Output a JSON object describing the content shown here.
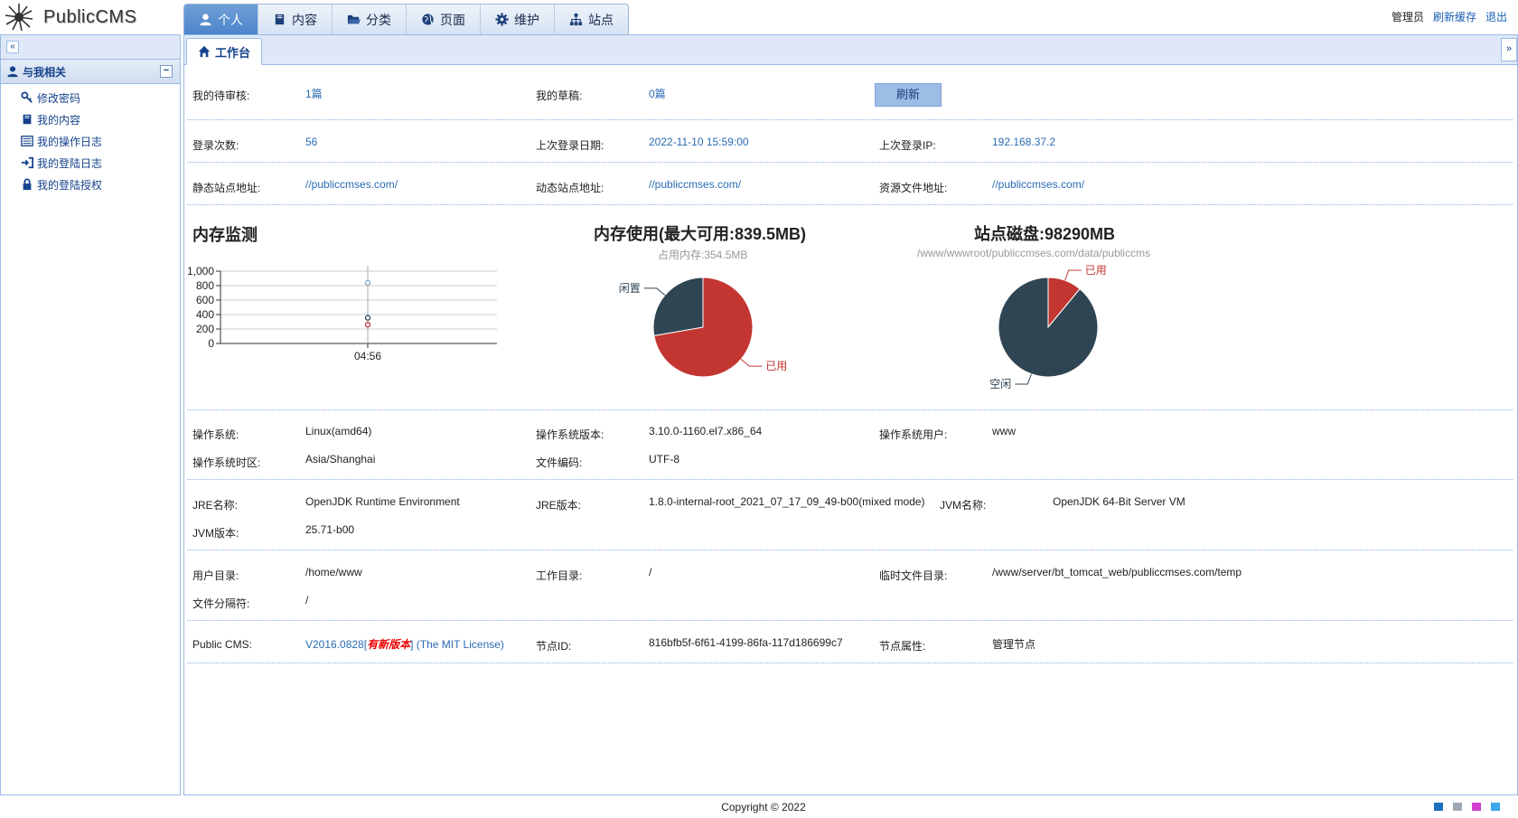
{
  "app": {
    "logo_text": "PublicCMS"
  },
  "nav": {
    "tabs": [
      {
        "label": "个人",
        "icon": "user-icon"
      },
      {
        "label": "内容",
        "icon": "book-icon"
      },
      {
        "label": "分类",
        "icon": "folder-open-icon"
      },
      {
        "label": "页面",
        "icon": "globe-icon"
      },
      {
        "label": "维护",
        "icon": "gear-icon"
      },
      {
        "label": "站点",
        "icon": "sitemap-icon"
      }
    ]
  },
  "header_right": {
    "user": "管理员",
    "refresh_cache": "刷新缓存",
    "logout": "退出"
  },
  "sidebar": {
    "section_title": "与我相关",
    "items": [
      {
        "label": "修改密码",
        "icon": "key-icon"
      },
      {
        "label": "我的内容",
        "icon": "book-icon"
      },
      {
        "label": "我的操作日志",
        "icon": "list-icon"
      },
      {
        "label": "我的登陆日志",
        "icon": "sign-in-icon"
      },
      {
        "label": "我的登陆授权",
        "icon": "lock-icon"
      }
    ]
  },
  "tabbar": {
    "active_tab": "工作台"
  },
  "info": {
    "pending_label": "我的待审核:",
    "pending_value": "1篇",
    "draft_label": "我的草稿:",
    "draft_value": "0篇",
    "refresh_button": "刷新",
    "login_count_label": "登录次数:",
    "login_count_value": "56",
    "last_login_date_label": "上次登录日期:",
    "last_login_date_value": "2022-11-10 15:59:00",
    "last_login_ip_label": "上次登录IP:",
    "last_login_ip_value": "192.168.37.2",
    "static_site_label": "静态站点地址:",
    "static_site_value": "//publiccmses.com/",
    "dynamic_site_label": "动态站点地址:",
    "dynamic_site_value": "//publiccmses.com/",
    "resource_label": "资源文件地址:",
    "resource_value": "//publiccmses.com/"
  },
  "charts": {
    "memory_monitor_title": "内存监测",
    "memory_usage_title": "内存使用(最大可用:839.5MB)",
    "memory_usage_sub": "占用内存:354.5MB",
    "disk_title": "站点磁盘:98290MB",
    "disk_sub": "/www/wwwroot/publiccmses.com/data/publiccms"
  },
  "chart_data": [
    {
      "type": "line",
      "title": "内存监测",
      "x": [
        "04:56"
      ],
      "yticks": [
        "1,000",
        "800",
        "600",
        "400",
        "200",
        "0"
      ],
      "ylim": [
        0,
        1000
      ],
      "series": [
        {
          "values": [
            839.5
          ],
          "color": "#7fa8c9"
        },
        {
          "values": [
            354.5
          ],
          "color": "#2f4554"
        },
        {
          "values": [
            260
          ],
          "color": "#c23531"
        }
      ]
    },
    {
      "type": "pie",
      "title": "内存使用(最大可用:839.5MB)",
      "labels": [
        "已用",
        "闲置"
      ],
      "values": [
        354.5,
        136
      ],
      "colors": [
        "#c23531",
        "#2f4554"
      ]
    },
    {
      "type": "pie",
      "title": "站点磁盘:98290MB",
      "labels": [
        "已用",
        "空闲"
      ],
      "values": [
        0.11,
        0.89
      ],
      "colors": [
        "#c23531",
        "#2f4554"
      ]
    }
  ],
  "system": {
    "os_label": "操作系统:",
    "os_value": "Linux(amd64)",
    "os_version_label": "操作系统版本:",
    "os_version_value": "3.10.0-1160.el7.x86_64",
    "os_user_label": "操作系统用户:",
    "os_user_value": "www",
    "os_tz_label": "操作系统时区:",
    "os_tz_value": "Asia/Shanghai",
    "file_encoding_label": "文件编码:",
    "file_encoding_value": "UTF-8",
    "jre_name_label": "JRE名称:",
    "jre_name_value": "OpenJDK Runtime Environment",
    "jre_version_label": "JRE版本:",
    "jre_version_value": "1.8.0-internal-root_2021_07_17_09_49-b00(mixed mode)",
    "jvm_name_label": "JVM名称:",
    "jvm_name_value": "OpenJDK 64-Bit Server VM",
    "jvm_version_label": "JVM版本:",
    "jvm_version_value": "25.71-b00",
    "user_dir_label": "用户目录:",
    "user_dir_value": "/home/www",
    "work_dir_label": "工作目录:",
    "work_dir_value": "/",
    "temp_dir_label": "临时文件目录:",
    "temp_dir_value": "/www/server/bt_tomcat_web/publiccmses.com/temp",
    "file_sep_label": "文件分隔符:",
    "file_sep_value": "/",
    "cms_label": "Public CMS:",
    "cms_version": "V2016.0828",
    "cms_new_version": "有新版本",
    "cms_license": "The MIT License",
    "node_id_label": "节点ID:",
    "node_id_value": "816bfb5f-6f61-4199-86fa-117d186699c7",
    "node_attr_label": "节点属性:",
    "node_attr_value": "管理节点"
  },
  "footer": {
    "copyright": "Copyright © 2022",
    "theme_colors": [
      "#1e6fc0",
      "#a0a7b4",
      "#d03fd0",
      "#3aa7e8"
    ]
  }
}
